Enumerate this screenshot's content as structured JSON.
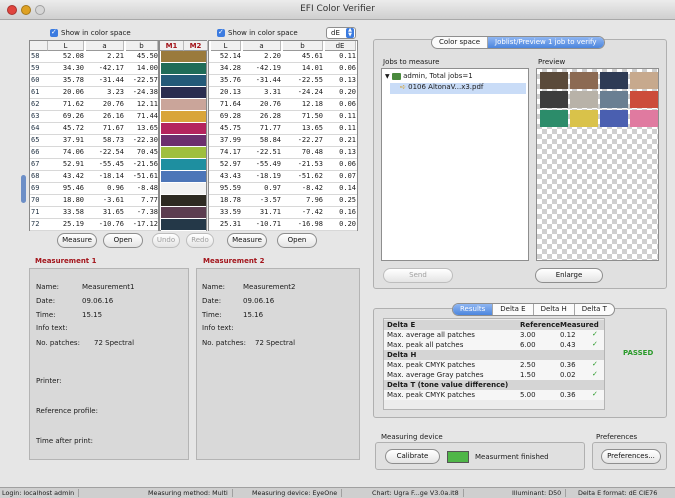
{
  "window": {
    "title": "EFI Color Verifier",
    "close_color": "#e0443e",
    "min_color": "#dea123",
    "max_color": "#d6d6d6"
  },
  "left_table": {
    "checkbox_label": "Show in color space",
    "columns": [
      "L",
      "a",
      "b"
    ],
    "rows": [
      {
        "id": "58",
        "L": "52.08",
        "a": "2.21",
        "b": "45.50"
      },
      {
        "id": "59",
        "L": "34.30",
        "a": "-42.17",
        "b": "14.00"
      },
      {
        "id": "60",
        "L": "35.78",
        "a": "-31.44",
        "b": "-22.57"
      },
      {
        "id": "61",
        "L": "20.06",
        "a": "3.23",
        "b": "-24.38"
      },
      {
        "id": "62",
        "L": "71.62",
        "a": "20.76",
        "b": "12.11"
      },
      {
        "id": "63",
        "L": "69.26",
        "a": "26.16",
        "b": "71.44"
      },
      {
        "id": "64",
        "L": "45.72",
        "a": "71.67",
        "b": "13.65"
      },
      {
        "id": "65",
        "L": "37.91",
        "a": "58.73",
        "b": "-22.30"
      },
      {
        "id": "66",
        "L": "74.06",
        "a": "-22.54",
        "b": "70.45"
      },
      {
        "id": "67",
        "L": "52.91",
        "a": "-55.45",
        "b": "-21.56"
      },
      {
        "id": "68",
        "L": "43.42",
        "a": "-18.14",
        "b": "-51.61"
      },
      {
        "id": "69",
        "L": "95.46",
        "a": "0.96",
        "b": "-8.48"
      },
      {
        "id": "70",
        "L": "18.80",
        "a": "-3.61",
        "b": "7.77"
      },
      {
        "id": "71",
        "L": "33.58",
        "a": "31.65",
        "b": "-7.38"
      },
      {
        "id": "72",
        "L": "25.19",
        "a": "-10.76",
        "b": "-17.12"
      }
    ]
  },
  "swatches": {
    "headers": [
      "M1",
      "M2"
    ],
    "colors": [
      "#9a7a3c",
      "#1f6c58",
      "#235a78",
      "#2a2d4f",
      "#caa59a",
      "#d9a53a",
      "#b4245e",
      "#6c2f6e",
      "#9fbf3e",
      "#1e8fa0",
      "#4d76b8",
      "#f2f2f2",
      "#2d2a22",
      "#5b3d50",
      "#243848"
    ]
  },
  "right_table": {
    "checkbox_label": "Show in color space",
    "dropdown_value": "dE",
    "columns": [
      "L",
      "a",
      "b",
      "dE"
    ],
    "rows": [
      {
        "L": "52.14",
        "a": "2.20",
        "b": "45.61",
        "dE": "0.11"
      },
      {
        "L": "34.28",
        "a": "-42.19",
        "b": "14.01",
        "dE": "0.06"
      },
      {
        "L": "35.76",
        "a": "-31.44",
        "b": "-22.55",
        "dE": "0.13"
      },
      {
        "L": "20.13",
        "a": "3.31",
        "b": "-24.24",
        "dE": "0.20"
      },
      {
        "L": "71.64",
        "a": "20.76",
        "b": "12.18",
        "dE": "0.06"
      },
      {
        "L": "69.28",
        "a": "26.28",
        "b": "71.50",
        "dE": "0.11"
      },
      {
        "L": "45.75",
        "a": "71.77",
        "b": "13.65",
        "dE": "0.11"
      },
      {
        "L": "37.99",
        "a": "58.84",
        "b": "-22.27",
        "dE": "0.21"
      },
      {
        "L": "74.17",
        "a": "-22.51",
        "b": "70.48",
        "dE": "0.13"
      },
      {
        "L": "52.97",
        "a": "-55.49",
        "b": "-21.53",
        "dE": "0.06"
      },
      {
        "L": "43.43",
        "a": "-18.19",
        "b": "-51.62",
        "dE": "0.07"
      },
      {
        "L": "95.59",
        "a": "0.97",
        "b": "-8.42",
        "dE": "0.14"
      },
      {
        "L": "18.78",
        "a": "-3.57",
        "b": "7.96",
        "dE": "0.25"
      },
      {
        "L": "33.59",
        "a": "31.71",
        "b": "-7.42",
        "dE": "0.16"
      },
      {
        "L": "25.31",
        "a": "-10.71",
        "b": "-16.98",
        "dE": "0.20"
      }
    ]
  },
  "buttons": {
    "measure1": "Measure",
    "open1": "Open",
    "undo": "Undo",
    "redo": "Redo",
    "measure2": "Measure",
    "open2": "Open",
    "send": "Send",
    "enlarge": "Enlarge",
    "calibrate": "Calibrate",
    "preferences": "Preferences..."
  },
  "measurement1": {
    "title": "Measurement 1",
    "name_label": "Name:",
    "name": "Measurement1",
    "date_label": "Date:",
    "date": "09.06.16",
    "time_label": "Time:",
    "time": "15.15",
    "info_label": "Info text:",
    "patches_label": "No. patches:",
    "patches": "72 Spectral",
    "printer_label": "Printer:",
    "ref_label": "Reference profile:",
    "after_label": "Time after print:"
  },
  "measurement2": {
    "title": "Measurement 2",
    "name_label": "Name:",
    "name": "Measurement2",
    "date_label": "Date:",
    "date": "09.06.16",
    "time_label": "Time:",
    "time": "15.16",
    "info_label": "Info text:",
    "patches_label": "No. patches:",
    "patches": "72 Spectral"
  },
  "top_tabs": [
    "Color space",
    "Joblist/Preview 1 job to verify"
  ],
  "jobs": {
    "title": "Jobs to measure",
    "root": "admin, Total jobs=1",
    "item": "0106 AltonaV...x3.pdf"
  },
  "preview": {
    "title": "Preview",
    "thumb_colors": [
      "#5a4a3a",
      "#8c6a52",
      "#2e3b55",
      "#c7a98d",
      "#3d3d3d",
      "#b8b2a8",
      "#6a7f92",
      "#cc4c3b",
      "#2c8c6a",
      "#d9c24a",
      "#4a5fb0",
      "#e07aa0"
    ]
  },
  "results": {
    "tabs": [
      "Results",
      "Delta E",
      "Delta H",
      "Delta T"
    ],
    "col_ref": "Reference",
    "col_meas": "Measured",
    "sections": [
      {
        "title": "Delta E",
        "rows": [
          {
            "label": "Max. average all patches",
            "ref": "3.00",
            "meas": "0.12"
          },
          {
            "label": "Max. peak all patches",
            "ref": "6.00",
            "meas": "0.43"
          }
        ]
      },
      {
        "title": "Delta H",
        "rows": [
          {
            "label": "Max. peak CMYK patches",
            "ref": "2.50",
            "meas": "0.36"
          },
          {
            "label": "Max. average Gray patches",
            "ref": "1.50",
            "meas": "0.02"
          }
        ]
      },
      {
        "title": "Delta T (tone value difference)",
        "rows": [
          {
            "label": "Max. peak CMYK patches",
            "ref": "5.00",
            "meas": "0.36"
          }
        ]
      }
    ],
    "status": "PASSED",
    "check_mark": "✓"
  },
  "measuring_device": {
    "title": "Measuring device",
    "status": "Measurment finished",
    "status_color": "#4fb648"
  },
  "preferences_group": {
    "title": "Preferences"
  },
  "statusbar": {
    "login": "Login: localhost admin",
    "method": "Measuring method: Multi",
    "device": "Measuring device: EyeOne",
    "chart": "Chart: Ugra F...ge V3.0a.it8",
    "illuminant": "Illuminant: D50",
    "format": "Delta E format: dE CIE76"
  }
}
